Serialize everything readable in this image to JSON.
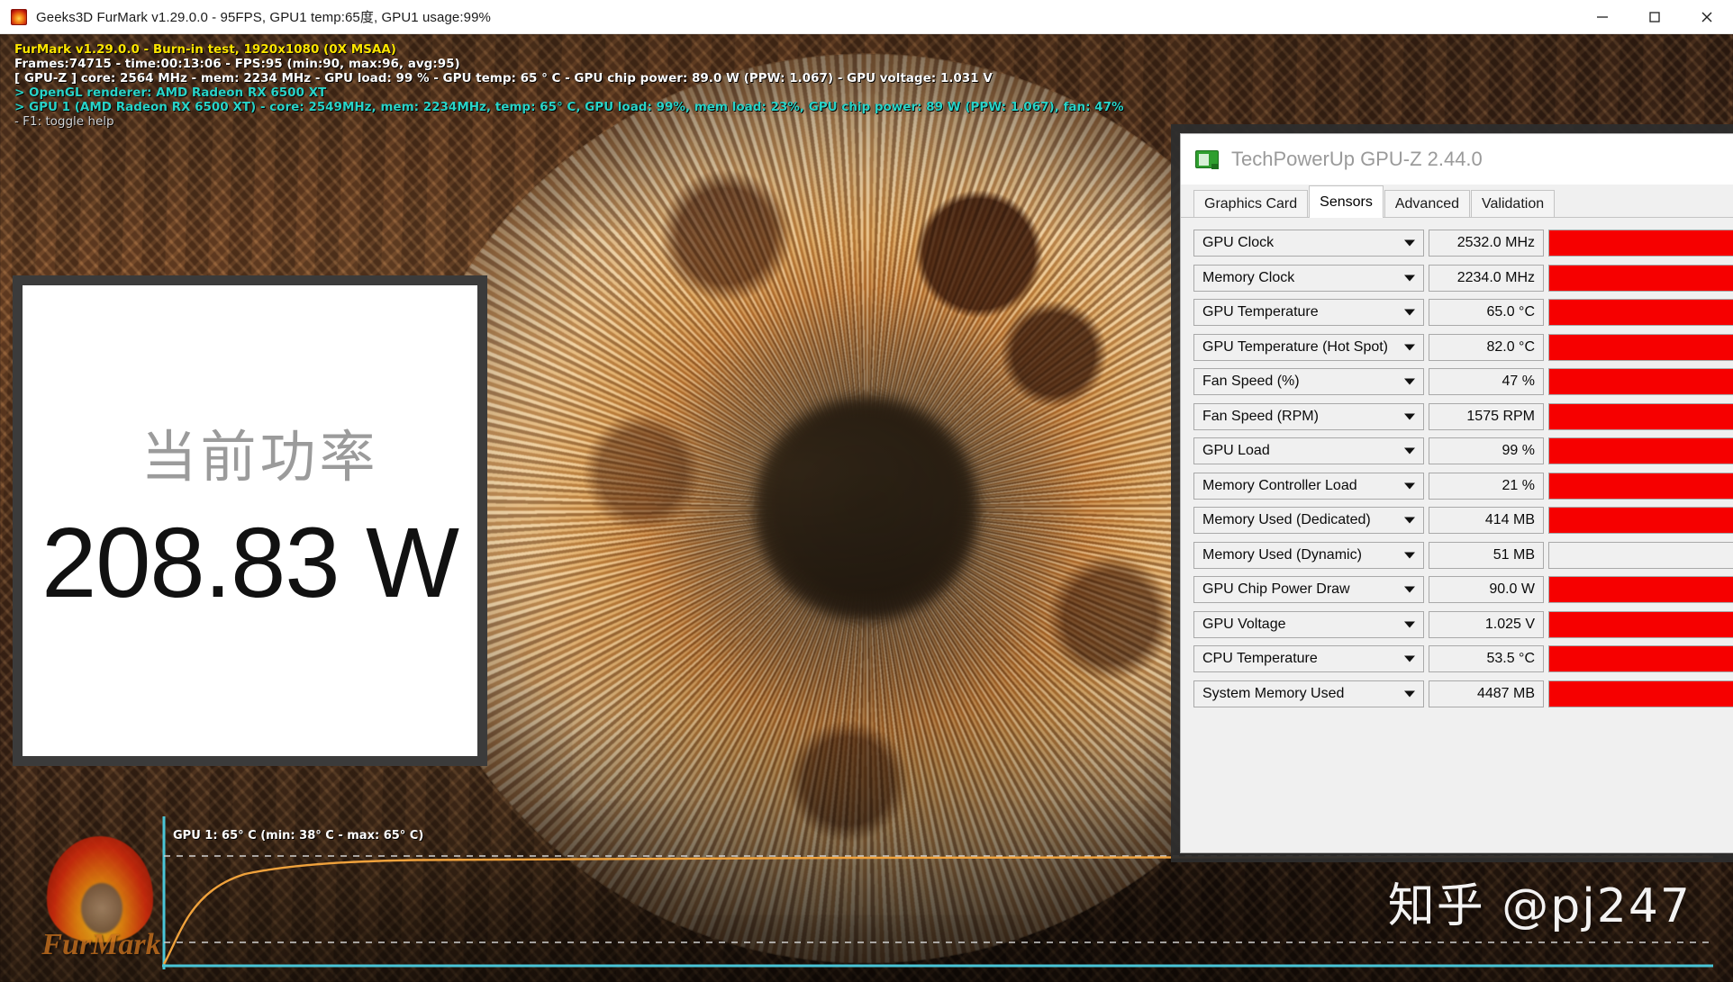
{
  "window": {
    "title": "Geeks3D FurMark v1.29.0.0 - 95FPS, GPU1 temp:65度, GPU1 usage:99%",
    "icon": "furmark-icon",
    "controls": {
      "minimize": "–",
      "maximize": "□",
      "close": "✕"
    }
  },
  "overlay": {
    "line1": "FurMark v1.29.0.0 - Burn-in test, 1920x1080 (0X MSAA)",
    "line2": "Frames:74715 - time:00:13:06 - FPS:95 (min:90, max:96, avg:95)",
    "line3": "[ GPU-Z ] core: 2564 MHz - mem: 2234 MHz - GPU load: 99 % - GPU temp: 65 ° C - GPU chip power: 89.0 W (PPW: 1.067) - GPU voltage: 1.031 V",
    "line4": "> OpenGL renderer: AMD Radeon RX 6500 XT",
    "line5": "> GPU 1 (AMD Radeon RX 6500 XT) - core: 2549MHz, mem: 2234MHz, temp: 65° C, GPU load: 99%, mem load: 23%, GPU chip power: 89 W (PPW: 1.067), fan: 47%",
    "line6": "- F1: toggle help"
  },
  "power_meter": {
    "label": "当前功率",
    "value": "208.83 W"
  },
  "graph": {
    "legend": "GPU 1: 65° C (min: 38° C - max: 65° C)",
    "line_color": "#f0a23c",
    "axis_color": "#49c6d8",
    "max_guide_color": "#cfcfcf"
  },
  "furmark_logo": {
    "word": "FurMark"
  },
  "watermark": "知乎 @pj247",
  "gpuz": {
    "title": "TechPowerUp GPU-Z 2.44.0",
    "logo": "graphics-card-icon",
    "minimize": "–",
    "tabs": [
      {
        "label": "Graphics Card",
        "active": false
      },
      {
        "label": "Sensors",
        "active": true
      },
      {
        "label": "Advanced",
        "active": false
      },
      {
        "label": "Validation",
        "active": false
      }
    ],
    "accent_color": "#f60000",
    "sensors": [
      {
        "name": "GPU Clock",
        "value": "2532.0 MHz",
        "bar": 100
      },
      {
        "name": "Memory Clock",
        "value": "2234.0 MHz",
        "bar": 100
      },
      {
        "name": "GPU Temperature",
        "value": "65.0 °C",
        "bar": 100
      },
      {
        "name": "GPU Temperature (Hot Spot)",
        "value": "82.0 °C",
        "bar": 96
      },
      {
        "name": "Fan Speed (%)",
        "value": "47 %",
        "bar": 100
      },
      {
        "name": "Fan Speed (RPM)",
        "value": "1575 RPM",
        "bar": 100
      },
      {
        "name": "GPU Load",
        "value": "99 %",
        "bar": 100
      },
      {
        "name": "Memory Controller Load",
        "value": "21 %",
        "bar": 100
      },
      {
        "name": "Memory Used (Dedicated)",
        "value": "414 MB",
        "bar": 100
      },
      {
        "name": "Memory Used (Dynamic)",
        "value": "51 MB",
        "bar": 0
      },
      {
        "name": "GPU Chip Power Draw",
        "value": "90.0 W",
        "bar": 100
      },
      {
        "name": "GPU Voltage",
        "value": "1.025 V",
        "bar": 100
      },
      {
        "name": "CPU Temperature",
        "value": "53.5 °C",
        "bar": 100
      },
      {
        "name": "System Memory Used",
        "value": "4487 MB",
        "bar": 100
      }
    ]
  }
}
